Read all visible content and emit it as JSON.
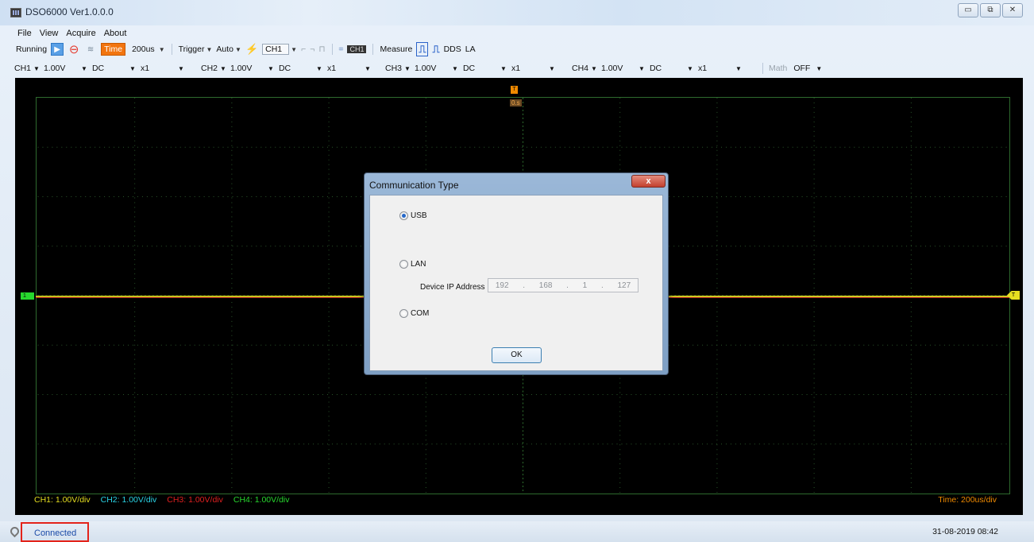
{
  "window": {
    "title": "DSO6000 Ver1.0.0.0",
    "controls": [
      "▭",
      "⧉",
      "✕"
    ]
  },
  "menu": [
    "File",
    "View",
    "Acquire",
    "About"
  ],
  "toolbar": {
    "running_label": "Running",
    "time_label": "Time",
    "timebase": "200us",
    "trigger_label": "Trigger",
    "trigger_mode": "Auto",
    "trigger_source": "CH1",
    "ch_chip": "CH1",
    "measure_label": "Measure",
    "dds_label": "DDS",
    "la_label": "LA"
  },
  "channels": [
    {
      "name": "CH1",
      "volts": "1.00V",
      "coupling": "DC",
      "probe": "x1"
    },
    {
      "name": "CH2",
      "volts": "1.00V",
      "coupling": "DC",
      "probe": "x1"
    },
    {
      "name": "CH3",
      "volts": "1.00V",
      "coupling": "DC",
      "probe": "x1"
    },
    {
      "name": "CH4",
      "volts": "1.00V",
      "coupling": "DC",
      "probe": "x1"
    }
  ],
  "math": {
    "label": "Math",
    "value": "OFF"
  },
  "scope": {
    "trigger_time": "0.s",
    "ch_left_marker": "1",
    "ch_right_marker": "T",
    "status": [
      {
        "text": "CH1: 1.00V/div",
        "color": "#e6df20"
      },
      {
        "text": "CH2: 1.00V/div",
        "color": "#2ad4e6"
      },
      {
        "text": "CH3: 1.00V/div",
        "color": "#e02020"
      },
      {
        "text": "CH4: 1.00V/div",
        "color": "#27d82e"
      }
    ],
    "time_div": "Time: 200us/div"
  },
  "dialog": {
    "title": "Communication Type",
    "close": "x",
    "usb": "USB",
    "lan": "LAN",
    "ip_label": "Device IP Address",
    "ip": [
      "192",
      "168",
      "1",
      "127"
    ],
    "com": "COM",
    "ok": "OK"
  },
  "statusbar": {
    "connection": "Connected",
    "datetime": "31-08-2019 08:42"
  }
}
